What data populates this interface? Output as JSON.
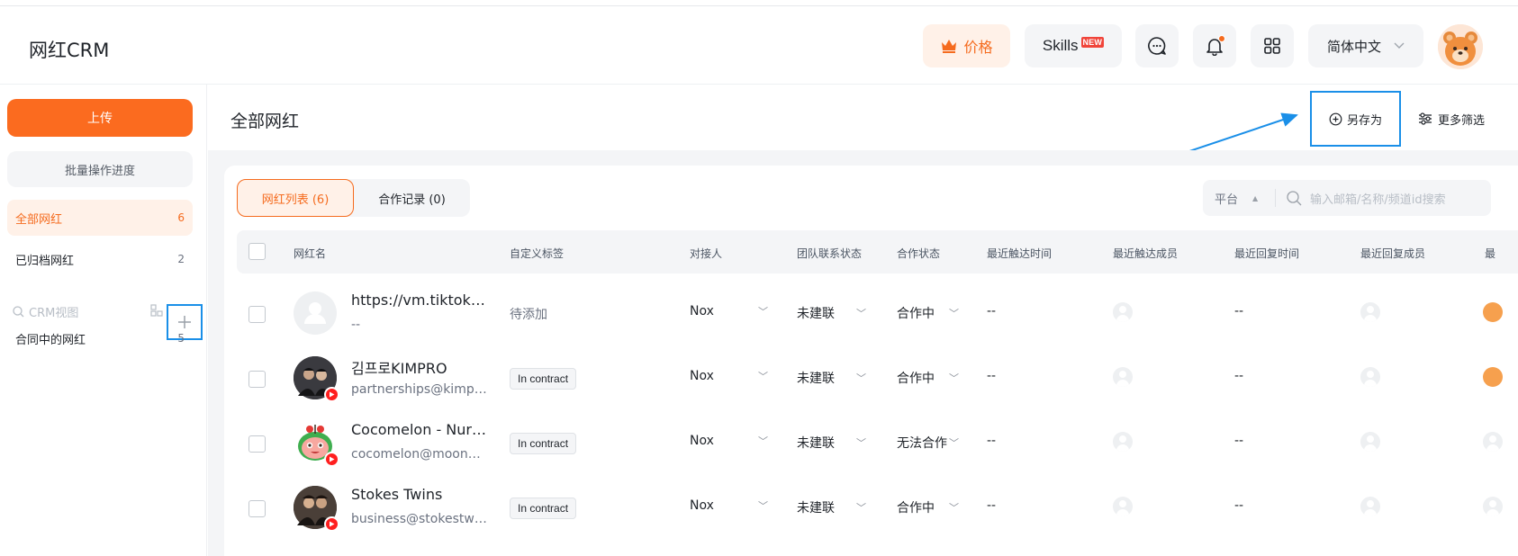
{
  "app": {
    "logo": "网红CRM"
  },
  "header": {
    "price_label": "价格",
    "skills_label": "Skills",
    "skills_badge": "NEW",
    "language": "简体中文",
    "accent_color": "#f56b1e"
  },
  "sidebar": {
    "upload_label": "上传",
    "batch_label": "批量操作进度",
    "items": [
      {
        "label": "全部网红",
        "count": "6"
      },
      {
        "label": "已归档网红",
        "count": "2"
      }
    ],
    "crm_search_placeholder": "CRM视图",
    "views": [
      {
        "label": "合同中的网红",
        "count": "5"
      }
    ]
  },
  "main": {
    "title": "全部网红",
    "save_as_label": "另存为",
    "more_filters_label": "更多筛选",
    "tabs": [
      {
        "label": "网红列表 (6)"
      },
      {
        "label": "合作记录 (0)"
      }
    ],
    "platform_label": "平台",
    "search_placeholder": "输入邮箱/名称/频道id搜索"
  },
  "table": {
    "columns": [
      "网红名",
      "自定义标签",
      "对接人",
      "团队联系状态",
      "合作状态",
      "最近触达时间",
      "最近触达成员",
      "最近回复时间",
      "最近回复成员",
      "最"
    ],
    "rows": [
      {
        "name": "https://vm.tiktok.com/...",
        "sub": "--",
        "tag": "待添加",
        "tag_type": "pending",
        "contact": "Nox",
        "team_status": "未建联",
        "coop_status": "合作中",
        "last_touch": "--",
        "last_reply": "--",
        "avatar": "placeholder"
      },
      {
        "name": "김프로KIMPRO",
        "sub": "partnerships@kimpro...",
        "tag": "In contract",
        "tag_type": "tag",
        "contact": "Nox",
        "team_status": "未建联",
        "coop_status": "合作中",
        "last_touch": "--",
        "last_reply": "--",
        "avatar": "person-dark"
      },
      {
        "name": "Cocomelon - Nursery Rhymes",
        "sub": "cocomelon@moonbug...",
        "tag": "In contract",
        "tag_type": "tag",
        "contact": "Nox",
        "team_status": "未建联",
        "coop_status": "无法合作",
        "last_touch": "--",
        "last_reply": "--",
        "avatar": "melon"
      },
      {
        "name": "Stokes Twins",
        "sub": "business@stokestwins...",
        "tag": "In contract",
        "tag_type": "tag",
        "contact": "Nox",
        "team_status": "未建联",
        "coop_status": "合作中",
        "last_touch": "--",
        "last_reply": "--",
        "avatar": "person-dark"
      }
    ]
  }
}
